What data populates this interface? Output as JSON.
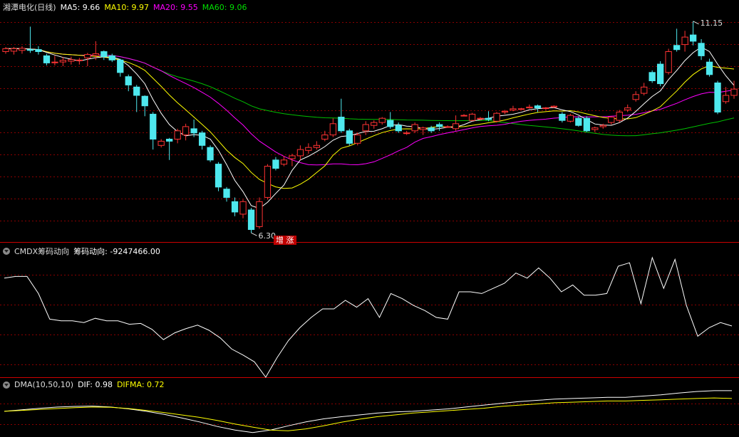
{
  "main": {
    "title": "湘潭电化(日线)",
    "ma5_label": "MA5: 9.66",
    "ma10_label": "MA10: 9.97",
    "ma20_label": "MA20: 9.55",
    "ma60_label": "MA60: 9.06",
    "high_label": "11.15",
    "low_label": "6.30",
    "badge": "增 涨"
  },
  "cmdx": {
    "name": "CMDX筹码动向",
    "value_label": "筹码动向: -9247466.00"
  },
  "dma": {
    "name": "DMA(10,50,10)",
    "dif_label": "DIF: 0.98",
    "difma_label": "DIFMA: 0.72"
  },
  "colors": {
    "up": "#ff3333",
    "down": "#4ee8ee",
    "ma5": "#ffffff",
    "ma10": "#ffff00",
    "ma20": "#ff00ff",
    "ma60": "#00c000",
    "grid": "#8b0000",
    "ref": "#cc0000"
  },
  "chart_data": [
    {
      "type": "candlestick",
      "ylim": [
        6.05,
        11.55
      ],
      "candles": [
        [
          10.55,
          10.62,
          10.5,
          10.66
        ],
        [
          10.56,
          10.62,
          10.48,
          10.66
        ],
        [
          10.58,
          10.63,
          10.5,
          10.68
        ],
        [
          10.6,
          10.58,
          10.52,
          11.15
        ],
        [
          10.6,
          10.55,
          10.48,
          10.68
        ],
        [
          10.45,
          10.28,
          10.22,
          10.5
        ],
        [
          10.3,
          10.3,
          10.22,
          10.45
        ],
        [
          10.3,
          10.34,
          10.2,
          10.42
        ],
        [
          10.32,
          10.36,
          10.24,
          10.43
        ],
        [
          10.34,
          10.35,
          10.24,
          10.4
        ],
        [
          10.4,
          10.48,
          10.2,
          10.52
        ],
        [
          10.46,
          10.5,
          10.35,
          10.8
        ],
        [
          10.55,
          10.43,
          10.35,
          10.58
        ],
        [
          10.45,
          10.35,
          10.3,
          10.5
        ],
        [
          10.35,
          10.05,
          9.95,
          10.38
        ],
        [
          9.95,
          9.75,
          9.6,
          10.0
        ],
        [
          9.7,
          9.5,
          9.1,
          9.75
        ],
        [
          9.48,
          9.25,
          9.0,
          9.5
        ],
        [
          9.05,
          8.45,
          8.2,
          9.1
        ],
        [
          8.3,
          8.4,
          8.25,
          8.45
        ],
        [
          8.45,
          8.4,
          7.95,
          8.48
        ],
        [
          8.45,
          8.65,
          8.35,
          8.7
        ],
        [
          8.55,
          8.75,
          8.42,
          8.82
        ],
        [
          8.7,
          8.6,
          8.5,
          8.92
        ],
        [
          8.6,
          8.3,
          8.2,
          8.65
        ],
        [
          8.25,
          7.95,
          7.9,
          8.3
        ],
        [
          7.85,
          7.3,
          7.2,
          7.9
        ],
        [
          7.25,
          7.05,
          6.95,
          7.3
        ],
        [
          6.95,
          6.7,
          6.6,
          7.05
        ],
        [
          6.65,
          6.95,
          6.55,
          7.0
        ],
        [
          6.75,
          6.28,
          6.2,
          6.8
        ],
        [
          6.35,
          6.95,
          6.3,
          7.05
        ],
        [
          7.05,
          7.8,
          7.0,
          7.85
        ],
        [
          7.95,
          7.75,
          7.7,
          8.02
        ],
        [
          7.85,
          7.95,
          7.8,
          8.05
        ],
        [
          7.98,
          8.05,
          7.8,
          8.1
        ],
        [
          8.05,
          8.2,
          7.95,
          8.3
        ],
        [
          8.18,
          8.25,
          8.1,
          8.35
        ],
        [
          8.25,
          8.3,
          8.2,
          8.4
        ],
        [
          8.45,
          8.55,
          8.4,
          8.65
        ],
        [
          8.55,
          8.82,
          8.5,
          8.95
        ],
        [
          8.98,
          8.65,
          8.6,
          9.42
        ],
        [
          8.65,
          8.35,
          8.3,
          8.7
        ],
        [
          8.35,
          8.55,
          8.3,
          8.6
        ],
        [
          8.65,
          8.8,
          8.55,
          8.88
        ],
        [
          8.78,
          8.85,
          8.7,
          8.9
        ],
        [
          8.85,
          8.95,
          8.8,
          8.98
        ],
        [
          8.9,
          8.75,
          8.7,
          9.1
        ],
        [
          8.78,
          8.65,
          8.6,
          8.85
        ],
        [
          8.6,
          8.6,
          8.55,
          8.65
        ],
        [
          8.65,
          8.8,
          8.6,
          8.85
        ],
        [
          8.68,
          8.72,
          8.55,
          8.75
        ],
        [
          8.72,
          8.65,
          8.6,
          8.77
        ],
        [
          8.8,
          8.75,
          8.65,
          8.85
        ],
        [
          8.75,
          8.75,
          8.72,
          8.78
        ],
        [
          8.7,
          8.82,
          8.65,
          9.02
        ],
        [
          9.02,
          9.02,
          9.0,
          9.05
        ],
        [
          8.9,
          9.05,
          8.88,
          9.08
        ],
        [
          8.95,
          8.95,
          8.9,
          8.98
        ],
        [
          8.95,
          8.92,
          8.88,
          9.12
        ],
        [
          8.88,
          9.07,
          8.85,
          9.1
        ],
        [
          9.1,
          9.12,
          9.05,
          9.15
        ],
        [
          9.15,
          9.18,
          9.12,
          9.25
        ],
        [
          9.18,
          9.18,
          9.15,
          9.2
        ],
        [
          9.2,
          9.22,
          9.18,
          9.28
        ],
        [
          9.25,
          9.2,
          9.1,
          9.28
        ],
        [
          9.2,
          9.2,
          9.15,
          9.22
        ],
        [
          9.22,
          9.24,
          9.2,
          9.26
        ],
        [
          9.05,
          8.9,
          8.85,
          9.1
        ],
        [
          8.88,
          9.02,
          8.85,
          9.06
        ],
        [
          8.95,
          8.78,
          8.75,
          9.0
        ],
        [
          8.95,
          8.65,
          8.62,
          9.0
        ],
        [
          8.68,
          8.72,
          8.62,
          8.75
        ],
        [
          8.75,
          8.78,
          8.7,
          8.82
        ],
        [
          8.85,
          8.98,
          8.8,
          9.0
        ],
        [
          8.9,
          9.1,
          8.85,
          9.15
        ],
        [
          9.15,
          9.2,
          9.1,
          9.28
        ],
        [
          9.4,
          9.52,
          9.35,
          9.6
        ],
        [
          9.55,
          9.7,
          9.5,
          9.8
        ],
        [
          10.05,
          9.85,
          9.8,
          10.1
        ],
        [
          10.25,
          9.78,
          9.72,
          10.32
        ],
        [
          10.05,
          10.55,
          10.0,
          10.62
        ],
        [
          10.7,
          10.6,
          10.55,
          11.1
        ],
        [
          10.72,
          10.9,
          10.55,
          11.05
        ],
        [
          10.95,
          10.8,
          10.7,
          11.28
        ],
        [
          10.75,
          10.45,
          10.35,
          10.85
        ],
        [
          10.3,
          10.0,
          9.95,
          10.38
        ],
        [
          9.8,
          9.1,
          9.05,
          9.85
        ],
        [
          9.35,
          9.5,
          9.3,
          9.7
        ],
        [
          9.5,
          9.65,
          9.42,
          9.85
        ]
      ]
    },
    {
      "type": "line",
      "name": "CMDX筹码动向",
      "values": [
        0.78,
        0.8,
        0.8,
        0.6,
        0.3,
        0.28,
        0.28,
        0.26,
        0.31,
        0.28,
        0.28,
        0.24,
        0.25,
        0.18,
        0.06,
        0.14,
        0.19,
        0.23,
        0.17,
        0.08,
        -0.05,
        -0.12,
        -0.2,
        -0.38,
        -0.15,
        0.05,
        0.2,
        0.32,
        0.42,
        0.42,
        0.52,
        0.44,
        0.54,
        0.32,
        0.6,
        0.54,
        0.46,
        0.4,
        0.32,
        0.3,
        0.62,
        0.62,
        0.6,
        0.66,
        0.72,
        0.84,
        0.78,
        0.9,
        0.78,
        0.62,
        0.7,
        0.58,
        0.58,
        0.6,
        0.92,
        0.96,
        0.48,
        1.02,
        0.66,
        1.0,
        0.46,
        0.1,
        0.2,
        0.26,
        0.22
      ]
    },
    {
      "type": "line",
      "ylim": [
        -0.5,
        1.0
      ],
      "series": [
        {
          "name": "DIF",
          "values": [
            0.3,
            0.35,
            0.4,
            0.44,
            0.46,
            0.47,
            0.44,
            0.38,
            0.3,
            0.2,
            0.08,
            -0.05,
            -0.2,
            -0.32,
            -0.4,
            -0.32,
            -0.18,
            -0.05,
            0.05,
            0.12,
            0.18,
            0.24,
            0.28,
            0.3,
            0.34,
            0.38,
            0.44,
            0.5,
            0.56,
            0.62,
            0.66,
            0.7,
            0.72,
            0.74,
            0.76,
            0.76,
            0.8,
            0.84,
            0.9,
            0.95,
            0.98,
            0.98
          ]
        },
        {
          "name": "DIFMA",
          "values": [
            0.3,
            0.33,
            0.36,
            0.39,
            0.42,
            0.44,
            0.43,
            0.39,
            0.33,
            0.26,
            0.18,
            0.1,
            0.0,
            -0.12,
            -0.22,
            -0.32,
            -0.34,
            -0.28,
            -0.18,
            -0.06,
            0.04,
            0.12,
            0.18,
            0.24,
            0.28,
            0.32,
            0.36,
            0.4,
            0.46,
            0.5,
            0.54,
            0.58,
            0.6,
            0.62,
            0.64,
            0.64,
            0.66,
            0.68,
            0.7,
            0.72,
            0.74,
            0.72
          ]
        }
      ]
    }
  ]
}
